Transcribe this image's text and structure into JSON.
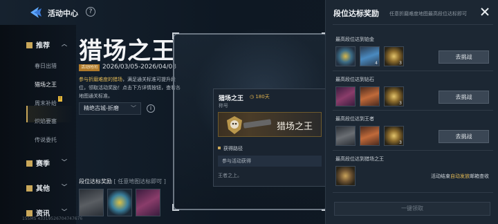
{
  "header": {
    "title": "活动中心",
    "help_label": "?"
  },
  "sidebar": {
    "categories": [
      {
        "label": "推荐",
        "sub": [
          "春日出猎",
          "猎场之王",
          "周末补给",
          "炽焰要塞",
          "传说委托"
        ]
      },
      {
        "label": "赛季"
      },
      {
        "label": "其他"
      },
      {
        "label": "资讯"
      }
    ],
    "sub_badge": "!"
  },
  "event": {
    "title": "猎场之王",
    "time_tag": "活动时间",
    "time_value": "2026/03/05-2026/04/08",
    "desc_lead": "参与折磨难度的猎场",
    "desc_rest": "，满足通关标准可提升段位，领取活动奖励！点击下方详情按钮，查看各地图通关标准。",
    "map_selector": "精绝古城-折磨",
    "info_label": "i",
    "strip_title": "段位达标奖励",
    "strip_hint": "[ 任意地图达标即可 ]",
    "footer": "155MS  43319526704747676"
  },
  "tooltip": {
    "name": "猎场之王",
    "days": "180天",
    "type": "称号",
    "banner_text": "猎场之王",
    "section": "获得路径",
    "source": "参与活动获得",
    "footer": "王者之上。"
  },
  "panel": {
    "title": "段位达标奖励",
    "subtitle": "任意折磨难度地图最高段位达标即可",
    "rows": [
      {
        "label": "最高段位达到铂金",
        "counts": [
          "",
          "4",
          "3"
        ],
        "button": "去挑战"
      },
      {
        "label": "最高段位达到钻石",
        "counts": [
          "",
          "",
          "3"
        ],
        "button": "去挑战"
      },
      {
        "label": "最高段位达到王者",
        "counts": [
          "",
          "",
          "3"
        ],
        "button": "去挑战"
      },
      {
        "label": "最高段位达到猎场之王",
        "counts": [
          ""
        ],
        "button": ""
      }
    ],
    "note_lead": "活动结束",
    "note_hl": "自动发放",
    "note_tail": "邮箱查收",
    "claim_button": "一键领取"
  }
}
